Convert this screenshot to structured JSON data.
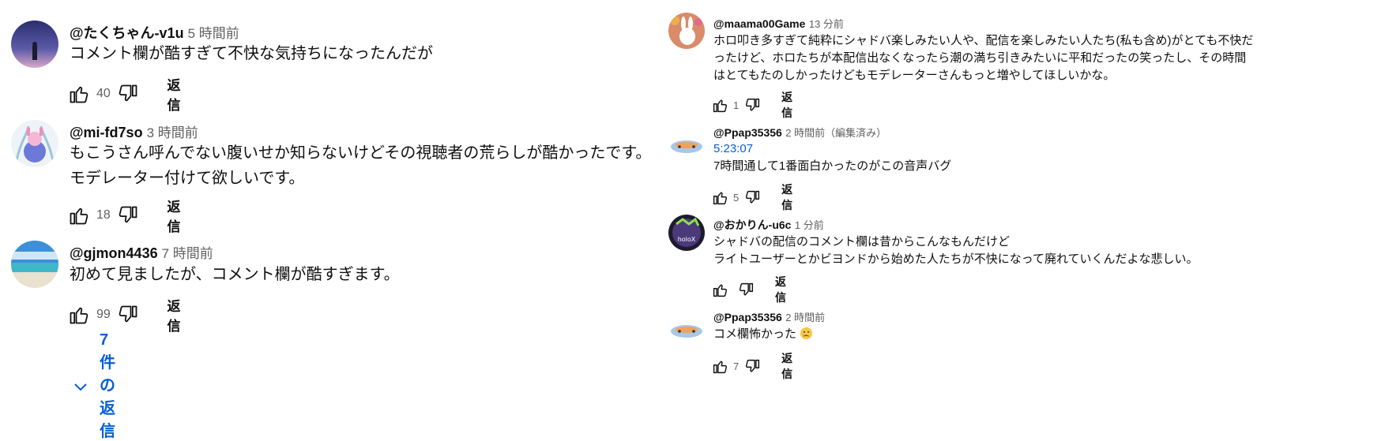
{
  "left_comments": [
    {
      "author": "@たくちゃん-v1u",
      "time": "5 時間前",
      "lines": [
        "コメント欄が酷すぎて不快な気持ちになったんだが"
      ],
      "likes": "40",
      "reply_label": "返信",
      "avatar": "night-sky-avatar"
    },
    {
      "author": "@mi-fd7so",
      "time": "3 時間前",
      "lines": [
        "もこうさん呼んでない腹いせか知らないけどその視聴者の荒らしが酷かったです。",
        "モデレーター付けて欲しいです。"
      ],
      "likes": "18",
      "reply_label": "返信",
      "avatar": "character-avatar"
    },
    {
      "author": "@gjmon4436",
      "time": "7 時間前",
      "lines": [
        "初めて見ましたが、コメント欄が酷すぎます。"
      ],
      "likes": "99",
      "reply_label": "返信",
      "avatar": "beach-avatar",
      "replies_label": "7 件の返信"
    }
  ],
  "right_comments": [
    {
      "author": "@maama00Game",
      "time": "13 分前",
      "lines": [
        "ホロ叩き多すぎて純粋にシャドバ楽しみたい人や、配信を楽しみたい人たち(私も含め)がとても不快だ",
        "ったけど、ホロたちが本配信出なくなったら潮の満ち引きみたいに平和だったの笑ったし、その時間",
        "はとてもたのしかったけどもモデレーターさんもっと増やしてほしいかな。"
      ],
      "likes": "1",
      "reply_label": "返信",
      "avatar": "rabbit-avatar"
    },
    {
      "author": "@Ppap35356",
      "time": "2 時間前（編集済み）",
      "timestamp_link": "5:23:07",
      "lines": [
        "7時間通して1番面白かったのがこの音声バグ"
      ],
      "likes": "5",
      "reply_label": "返信",
      "avatar": "fish-avatar"
    },
    {
      "author": "@おかりん-u6c",
      "time": "1 分前",
      "lines": [
        "シャドバの配信のコメント欄は昔からこんなもんだけど",
        "ライトユーザーとかビヨンドから始めた人たちが不快になって廃れていくんだよな悲しい。"
      ],
      "likes": "",
      "reply_label": "返信",
      "avatar": "holox-avatar"
    },
    {
      "author": "@Ppap35356",
      "time": "2 時間前",
      "lines": [
        "コメ欄怖かった"
      ],
      "emoji": "crying-face",
      "likes": "7",
      "reply_label": "返信",
      "avatar": "fish-avatar"
    }
  ],
  "colors": {
    "link": "#065fd4",
    "meta": "#606060",
    "text": "#0f0f0f"
  }
}
